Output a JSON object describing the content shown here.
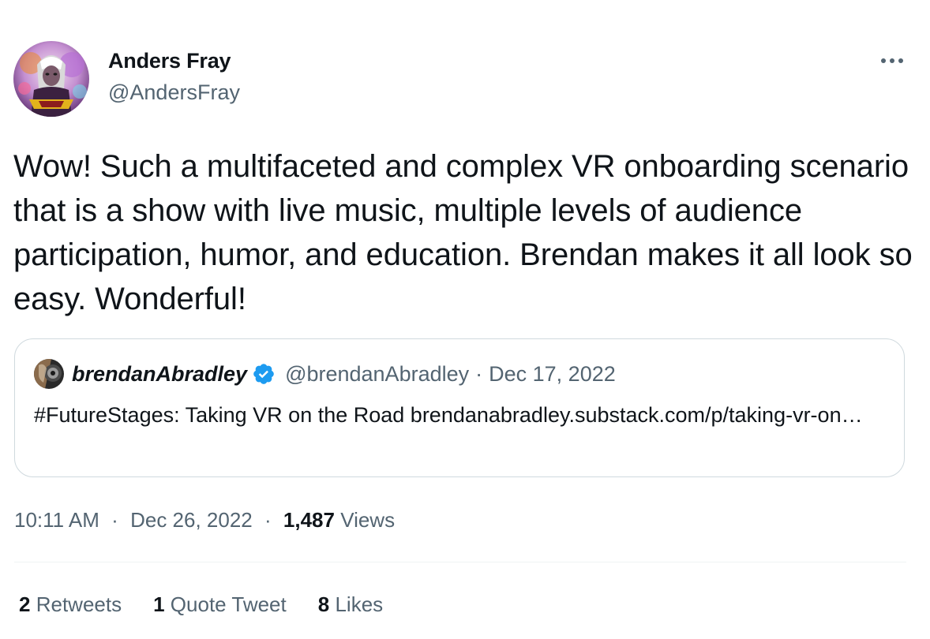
{
  "author": {
    "name": "Anders Fray",
    "handle": "@AndersFray",
    "avatar_icon": "profile-avatar"
  },
  "more_icon": "more-dots-icon",
  "tweet": {
    "text": "Wow! Such a multifaceted and complex VR onboarding scenario that is a show with live music, multiple levels of audience participation, humor, and education. Brendan makes it all look so easy. Wonderful!"
  },
  "quote": {
    "name": "brendanAbradley",
    "verified": true,
    "handle": "@brendanAbradley",
    "separator": "·",
    "date": "Dec 17, 2022",
    "text": "#FutureStages: Taking VR on the Road brendanabradley.substack.com/p/taking-vr-on…"
  },
  "meta": {
    "time": "10:11 AM",
    "separator": "·",
    "date": "Dec 26, 2022",
    "views_count": "1,487",
    "views_label": "Views"
  },
  "stats": [
    {
      "count": "2",
      "label": "Retweets"
    },
    {
      "count": "1",
      "label": "Quote Tweet"
    },
    {
      "count": "8",
      "label": "Likes"
    }
  ],
  "colors": {
    "text_primary": "#0f1419",
    "text_secondary": "#536471",
    "border": "#cfd9de",
    "verified_blue": "#1d9bf0"
  }
}
